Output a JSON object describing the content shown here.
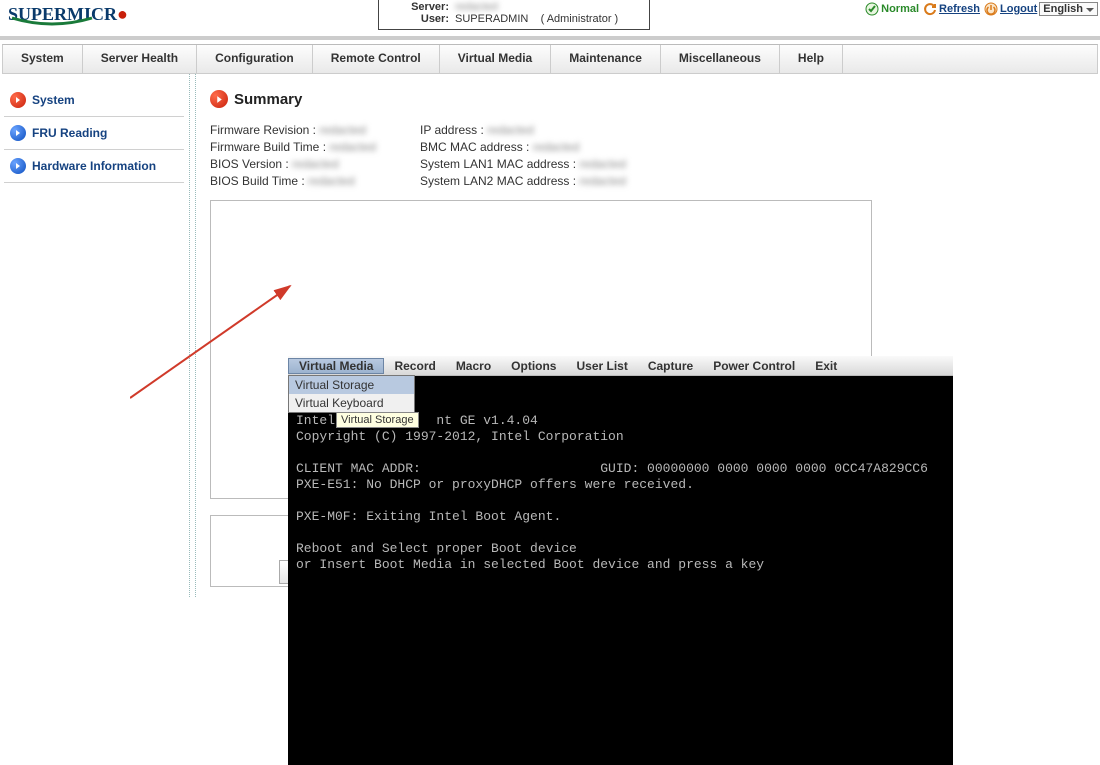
{
  "header": {
    "server_label": "Server:",
    "server_value": "redacted",
    "user_label": "User:",
    "user_value": "SUPERADMIN",
    "user_role": "( Administrator )",
    "status_ok": "Normal",
    "refresh": "Refresh",
    "logout": "Logout",
    "lang": "English"
  },
  "menubar": [
    "System",
    "Server Health",
    "Configuration",
    "Remote Control",
    "Virtual Media",
    "Maintenance",
    "Miscellaneous",
    "Help"
  ],
  "sidebar": [
    {
      "label": "System",
      "color": "red"
    },
    {
      "label": "FRU Reading",
      "color": "blue"
    },
    {
      "label": "Hardware Information",
      "color": "blue"
    }
  ],
  "page": {
    "title": "Summary",
    "left": [
      {
        "label": "Firmware Revision :",
        "val": "redacted"
      },
      {
        "label": "Firmware Build Time :",
        "val": "redacted"
      },
      {
        "label": "BIOS Version :",
        "val": "redacted"
      },
      {
        "label": "BIOS Build Time :",
        "val": "redacted"
      }
    ],
    "right": [
      {
        "label": "IP address :",
        "val": "redacted"
      },
      {
        "label": "BMC MAC address :",
        "val": "redacted"
      },
      {
        "label": "System LAN1 MAC address :",
        "val": "redacted"
      },
      {
        "label": "System LAN2 MAC address :",
        "val": "redacted"
      }
    ]
  },
  "console_menu": [
    "Virtual Media",
    "Record",
    "Macro",
    "Options",
    "User List",
    "Capture",
    "Power Control",
    "Exit"
  ],
  "vm_dropdown": [
    "Virtual Storage",
    "Virtual Keyboard"
  ],
  "tooltip": "Virtual Storage",
  "console_text": "Intel ...         nt GE v1.4.04\nCopyright (C) 1997-2012, Intel Corporation\n\nCLIENT MAC ADDR:                       GUID: 00000000 0000 0000 0000 0CC47A829CC6\nPXE-E51: No DHCP or proxyDHCP offers were received.\n\nPXE-M0F: Exiting Intel Boot Agent.\n\nReboot and Select proper Boot device\nor Insert Boot Media in selected Boot device and press a key"
}
